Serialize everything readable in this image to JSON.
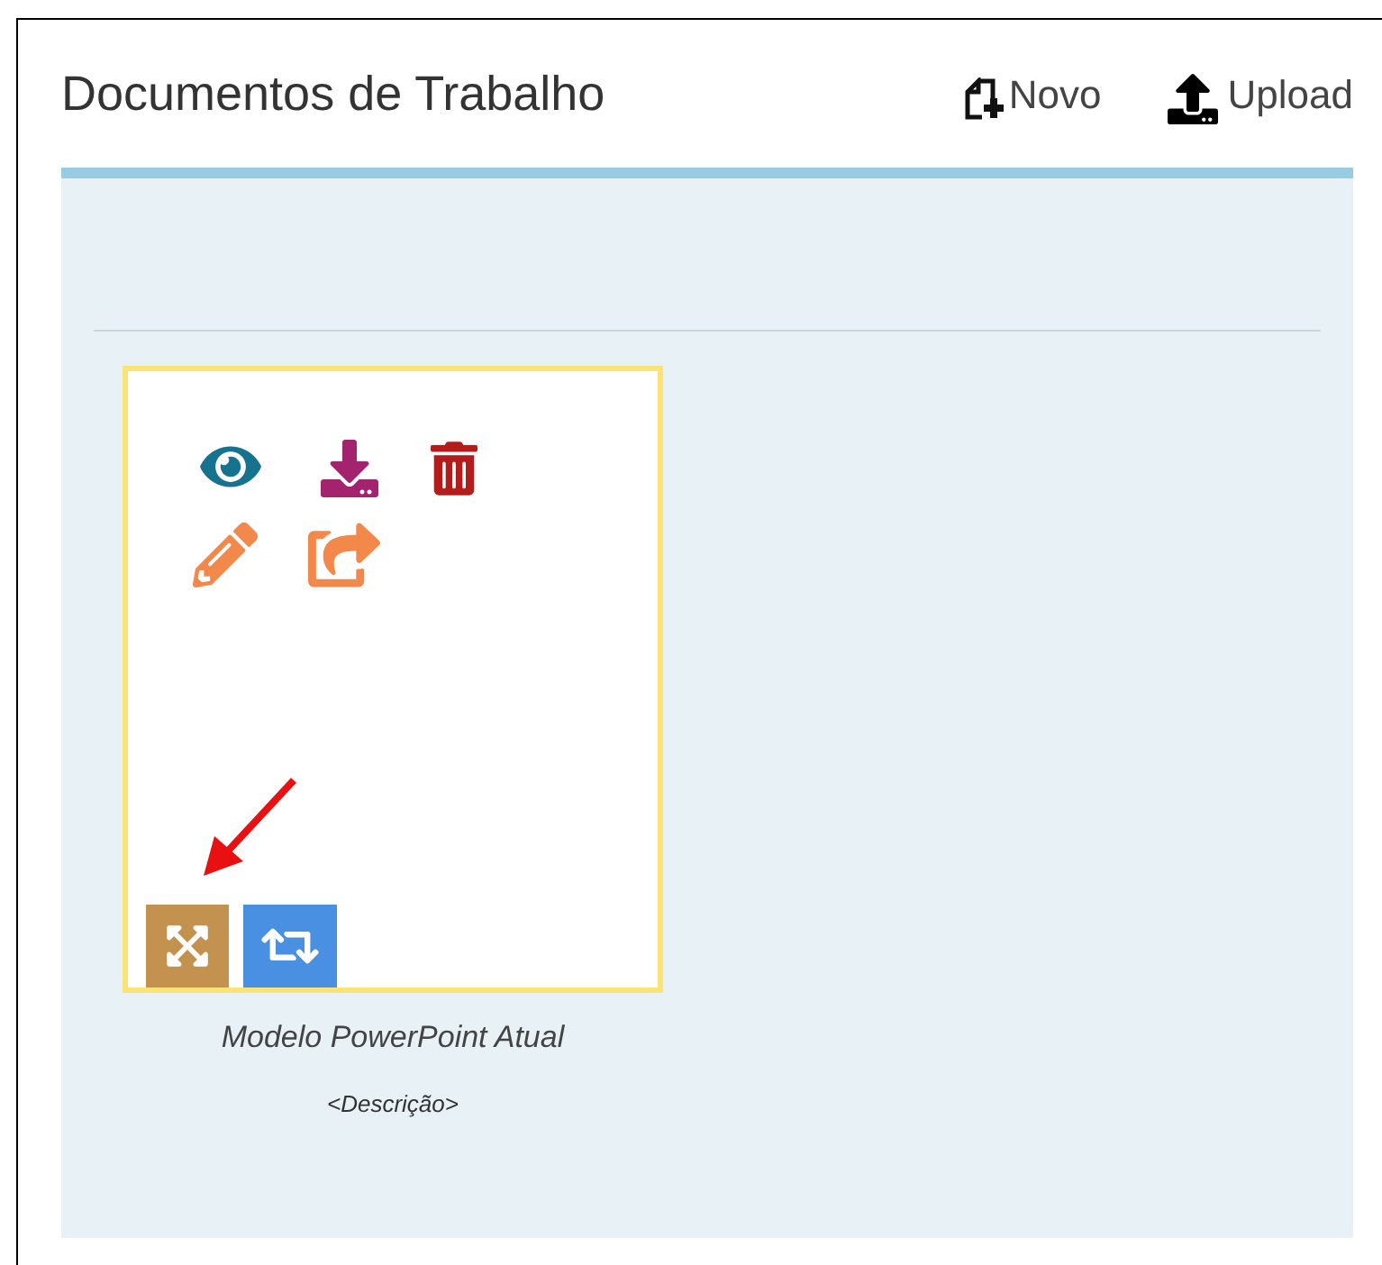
{
  "header": {
    "title": "Documentos de Trabalho",
    "actions": [
      {
        "kind": "new",
        "label": "Novo"
      },
      {
        "kind": "upload",
        "label": "Upload"
      }
    ]
  },
  "documents": [
    {
      "name": "Modelo PowerPoint Atual",
      "description": "<Descrição>"
    }
  ]
}
